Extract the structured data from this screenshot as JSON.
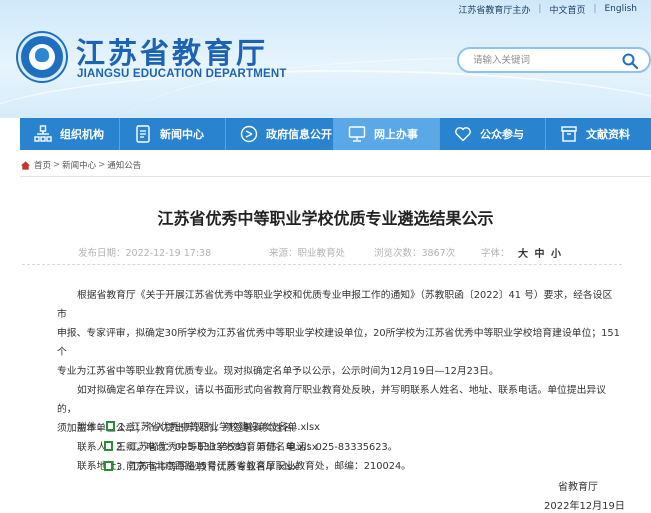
{
  "top_links": {
    "host": "江苏省教育厅主办",
    "chinese_home": "中文首页",
    "english": "English"
  },
  "header": {
    "title": "江苏省教育厅",
    "subtitle": "JIANGSU EDUCATION DEPARTMENT",
    "logo_icon": "jiangsu-education-emblem",
    "brand_color": "#1d63b4"
  },
  "search": {
    "placeholder": "请输入关键词",
    "icon": "search-icon"
  },
  "nav": {
    "accent": "#2a83cf",
    "active_color": "#5aa9e6",
    "items": [
      {
        "label": "组织机构",
        "icon": "org-chart-icon"
      },
      {
        "label": "新闻中心",
        "icon": "document-icon"
      },
      {
        "label": "政府信息公开",
        "icon": "search-list-icon"
      },
      {
        "label": "网上办事",
        "icon": "monitor-icon",
        "active": true
      },
      {
        "label": "公众参与",
        "icon": "heart-icon"
      },
      {
        "label": "文献资料",
        "icon": "archive-icon"
      }
    ]
  },
  "breadcrumb": {
    "home": "首页",
    "items": [
      "新闻中心",
      "通知公告"
    ]
  },
  "article": {
    "title": "江苏省优秀中等职业学校优质专业遴选结果公示",
    "meta": {
      "date": "发布日期：2022-12-19 17:38",
      "source": "来源：职业教育处",
      "views": "浏览次数：3867次",
      "font_label": "字体：",
      "size_large": "大",
      "size_medium": "中",
      "size_small": "小"
    },
    "paragraphs": {
      "p1_line1": "根据省教育厅《关于开展江苏省优秀中等职业学校和优质专业申报工作的通知》（苏教职函〔2022〕41 号）要求，经各设区市",
      "p1_line2": "申报、专家评审，拟确定30所学校为江苏省优秀中等职业学校建设单位，20所学校为江苏省优秀中等职业学校培育建设单位；151个",
      "p1_line3": "专业为江苏省中等职业教育优质专业。现对拟确定名单予以公示，公示时间为12月19日—12月23日。",
      "p2_line1": "如对拟确定名单存在异议，请以书面形式向省教育厅职业教育处反映，并写明联系人姓名、地址、联系电话。单位提出异议的，",
      "p2_line2": "须加盖本单位公章；个人提出异议的，须签署真实姓名。",
      "contacts": "联系人：王卿，电话：025-83335583；万玮，电话：025-83335623。",
      "address": "联系地址：南京市北京西路15号江苏省教育厅职业教育处，邮编：210024。"
    },
    "attachments": {
      "label": "附件：",
      "items": [
        "1. 江苏省优秀中等职业学校建设单位名单.xlsx",
        "2. 江苏省优秀中等职业学校培育单位名单.xlsx",
        "3. 江苏省中等职业教育优质专业名单.xlsx"
      ]
    },
    "signature": {
      "org": "省教育厅",
      "date": "2022年12月19日"
    }
  }
}
